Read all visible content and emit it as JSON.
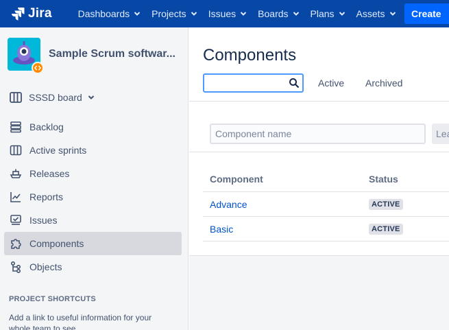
{
  "nav": {
    "logo_text": "Jira",
    "items": [
      {
        "label": "Dashboards"
      },
      {
        "label": "Projects"
      },
      {
        "label": "Issues"
      },
      {
        "label": "Boards"
      },
      {
        "label": "Plans"
      },
      {
        "label": "Assets"
      }
    ],
    "create_label": "Create"
  },
  "sidebar": {
    "project_name": "Sample Scrum softwar...",
    "board_label": "SSSD board",
    "items": [
      {
        "label": "Backlog",
        "icon": "backlog-icon"
      },
      {
        "label": "Active sprints",
        "icon": "board-icon"
      },
      {
        "label": "Releases",
        "icon": "ship-icon"
      },
      {
        "label": "Reports",
        "icon": "chart-icon"
      },
      {
        "label": "Issues",
        "icon": "issues-icon"
      },
      {
        "label": "Components",
        "icon": "puzzle-icon",
        "selected": true
      },
      {
        "label": "Objects",
        "icon": "objects-icon"
      }
    ],
    "shortcuts_heading": "PROJECT SHORTCUTS",
    "shortcuts_text": "Add a link to useful information for your whole team to see."
  },
  "main": {
    "title": "Components",
    "search_value": "",
    "tabs": [
      {
        "label": "Active"
      },
      {
        "label": "Archived"
      }
    ],
    "name_placeholder": "Component name",
    "lead_placeholder": "Lead",
    "columns": [
      "Component",
      "Status"
    ],
    "rows": [
      {
        "component": "Advance",
        "status": "ACTIVE"
      },
      {
        "component": "Basic",
        "status": "ACTIVE"
      }
    ]
  },
  "colors": {
    "nav_bg": "#0747a6",
    "create_bg": "#0065ff",
    "link": "#0052cc",
    "sidebar_bg": "#f4f5f7",
    "selected_bg": "#d7d9de"
  }
}
